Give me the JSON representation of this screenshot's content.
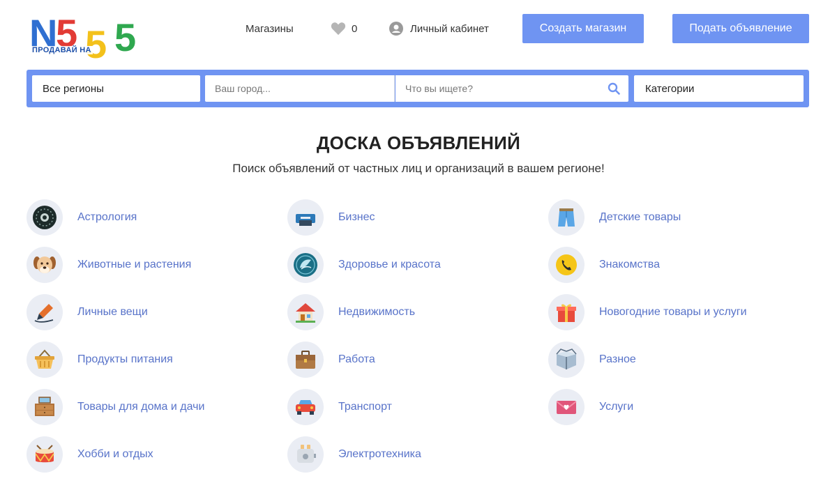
{
  "logo": {
    "letter": "N",
    "digits": [
      "5",
      "5",
      "5"
    ],
    "tagline": "ПРОДАВАЙ НА"
  },
  "header": {
    "shops": "Магазины",
    "favorites_count": "0",
    "cabinet": "Личный кабинет",
    "create_shop": "Создать магазин",
    "post_ad": "Подать объявление"
  },
  "search": {
    "region": "Все регионы",
    "city_placeholder": "Ваш город...",
    "query_placeholder": "Что вы ищете?",
    "category": "Категории"
  },
  "main": {
    "title": "ДОСКА ОБЪЯВЛЕНИЙ",
    "subtitle": "Поиск объявлений от частных лиц и организаций в вашем регионе!"
  },
  "categories": [
    {
      "label": "Астрология",
      "icon": "zodiac-icon"
    },
    {
      "label": "Бизнес",
      "icon": "printer-icon"
    },
    {
      "label": "Детские товары",
      "icon": "shorts-icon"
    },
    {
      "label": "Животные и растения",
      "icon": "dog-icon"
    },
    {
      "label": "Здоровье и красота",
      "icon": "lotus-icon"
    },
    {
      "label": "Знакомства",
      "icon": "phone-icon"
    },
    {
      "label": "Личные вещи",
      "icon": "pen-icon"
    },
    {
      "label": "Недвижимость",
      "icon": "house-icon"
    },
    {
      "label": "Новогодние товары и услуги",
      "icon": "gift-icon"
    },
    {
      "label": "Продукты питания",
      "icon": "basket-icon"
    },
    {
      "label": "Работа",
      "icon": "briefcase-icon"
    },
    {
      "label": "Разное",
      "icon": "box-icon"
    },
    {
      "label": "Товары для дома и дачи",
      "icon": "dresser-icon"
    },
    {
      "label": "Транспорт",
      "icon": "car-icon"
    },
    {
      "label": "Услуги",
      "icon": "envelope-icon"
    },
    {
      "label": "Хобби и отдых",
      "icon": "drum-icon"
    },
    {
      "label": "Электротехника",
      "icon": "toaster-icon"
    }
  ]
}
